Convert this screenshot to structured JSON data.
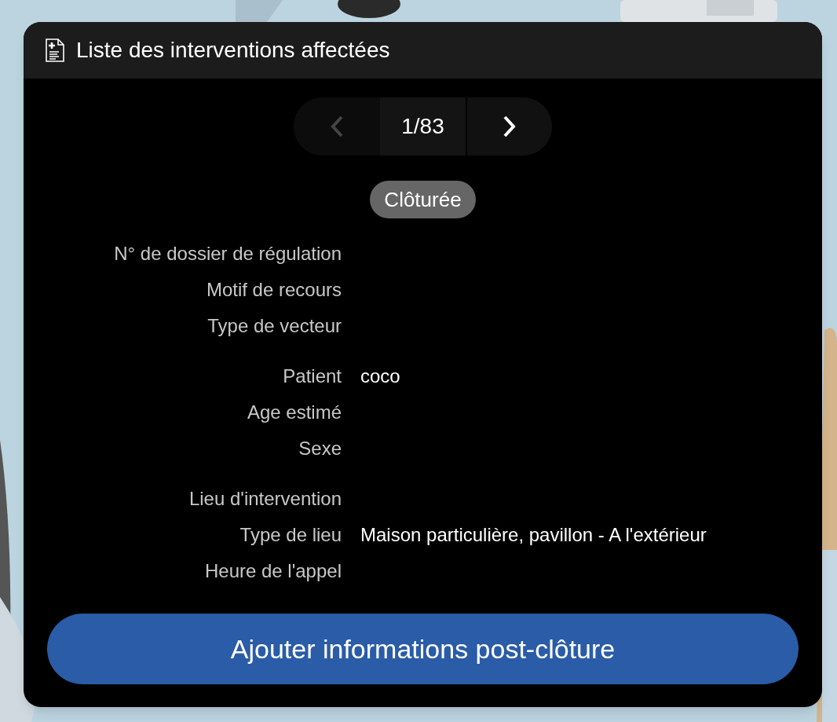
{
  "panel": {
    "title": "Liste des interventions affectées"
  },
  "pager": {
    "page": "1/83",
    "previous_disabled": true,
    "next_disabled": false
  },
  "status": "Clôturée",
  "groups": [
    [
      {
        "label": "N° de dossier de régulation"
      },
      {
        "label": "Motif de recours"
      },
      {
        "label": "Type de vecteur"
      }
    ],
    [
      {
        "label": "Patient",
        "value": "coco"
      },
      {
        "label": "Age estimé"
      },
      {
        "label": "Sexe"
      }
    ],
    [
      {
        "label": "Lieu d'intervention"
      },
      {
        "label": "Type de lieu",
        "value": "Maison particulière, pavillon - A l'extérieur"
      },
      {
        "label": "Heure de l'appel"
      }
    ]
  ],
  "action_button": "Ajouter informations post-clôture"
}
